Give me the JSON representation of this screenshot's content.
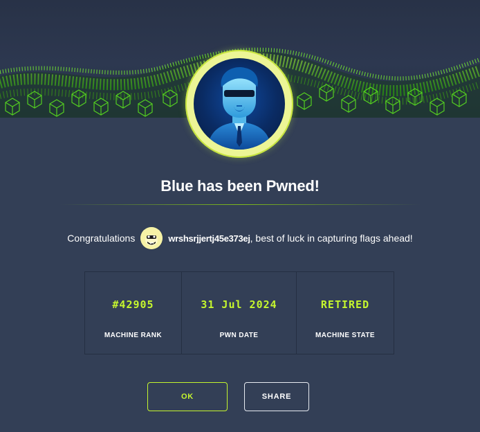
{
  "modal": {
    "title": "Blue has been Pwned!",
    "congrats_prefix": "Congratulations",
    "username": "wrshsrjjertj45e373ej",
    "congrats_suffix": ", best of luck in capturing flags ahead!"
  },
  "stats": [
    {
      "value": "#42905",
      "label": "MACHINE RANK"
    },
    {
      "value": "31 Jul 2024",
      "label": "PWN DATE"
    },
    {
      "value": "RETIRED",
      "label": "MACHINE STATE"
    }
  ],
  "buttons": {
    "ok_label": "OK",
    "share_label": "SHARE"
  },
  "colors": {
    "background": "#333f56",
    "accent_green": "#9fef00",
    "accent_yellow": "#c5f62e",
    "text": "#ffffff"
  },
  "icons": {
    "banner": "green-hexagon-wave-banner",
    "machine_avatar": "blue-agent-avatar",
    "user_avatar": "yellow-cartoon-avatar"
  }
}
